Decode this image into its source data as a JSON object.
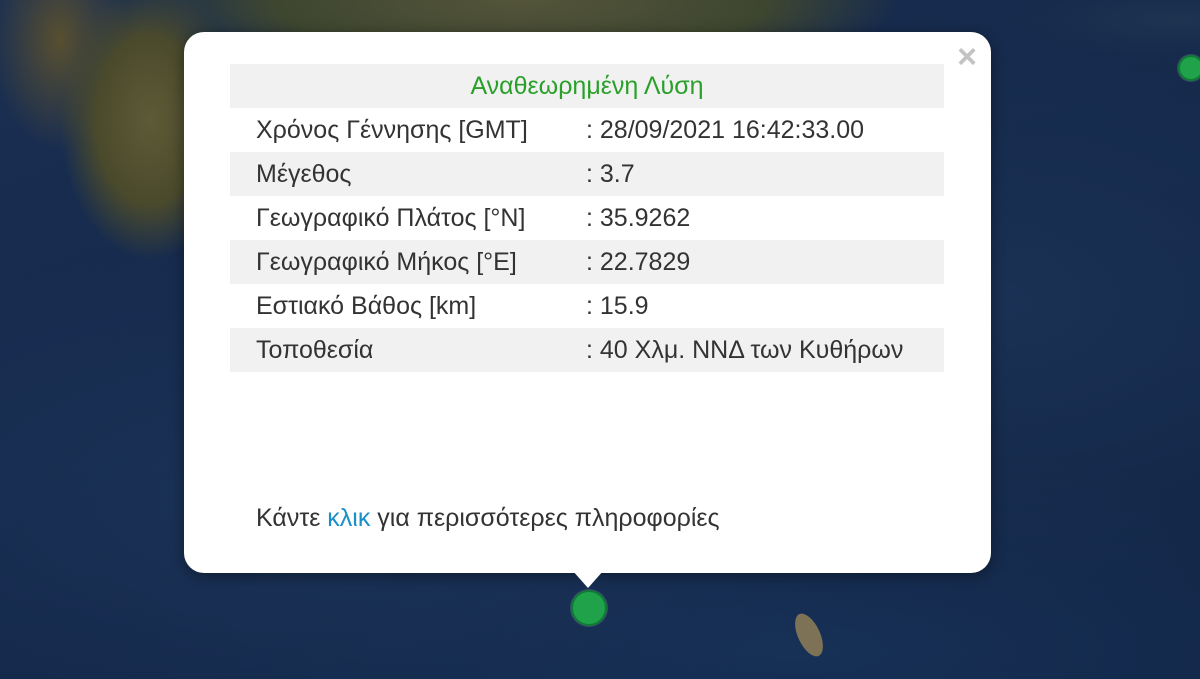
{
  "popup": {
    "title": "Αναθεωρημένη Λύση",
    "close_label": "×",
    "rows": [
      {
        "label": "Χρόνος Γέννησης [GMT]",
        "value": ": 28/09/2021 16:42:33.00"
      },
      {
        "label": "Μέγεθος",
        "value": ": 3.7"
      },
      {
        "label": "Γεωγραφικό Πλάτος [°N]",
        "value": ": 35.9262"
      },
      {
        "label": "Γεωγραφικό Μήκος [°E]",
        "value": ": 22.7829"
      },
      {
        "label": "Εστιακό Βάθος [km]",
        "value": ": 15.9"
      },
      {
        "label": "Τοποθεσία",
        "value": ": 40 Χλμ. ΝΝΔ των Κυθήρων"
      }
    ],
    "footer": {
      "before": "Κάντε ",
      "link": "κλικ",
      "after": " για περισσότερες πληροφορίες"
    }
  },
  "map": {
    "marker_color": "#1fa24a"
  }
}
